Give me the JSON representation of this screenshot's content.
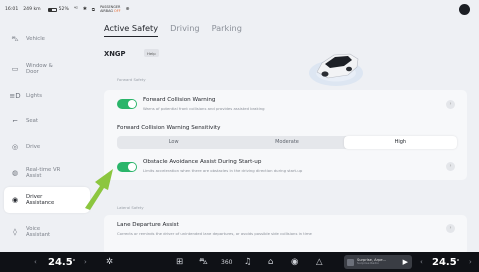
{
  "status": {
    "time": "16:01",
    "range": "249 km",
    "battery": "52%",
    "signal": "⁴ᴳ",
    "bluetooth": "✱",
    "camera": "⧉",
    "airbag_line1": "PASSENGER",
    "airbag_line2": "AIRBAG",
    "airbag_off": "OFF",
    "extra": "⊕"
  },
  "sidebar": {
    "items": [
      {
        "label": "Vehicle",
        "icon": "car-icon",
        "glyph": "⛍"
      },
      {
        "label": "Window &\nDoor",
        "icon": "window-icon",
        "glyph": "▭"
      },
      {
        "label": "Lights",
        "icon": "lights-icon",
        "glyph": "≡D"
      },
      {
        "label": "Seat",
        "icon": "seat-icon",
        "glyph": "⌐"
      },
      {
        "label": "Drive",
        "icon": "steering-icon",
        "glyph": "◎"
      },
      {
        "label": "Real-time VR\nAssist",
        "icon": "vr-icon",
        "glyph": "◍"
      },
      {
        "label": "Driver\nAssistance",
        "icon": "driver-assist-icon",
        "glyph": "◉"
      },
      {
        "label": "Voice\nAssistant",
        "icon": "voice-icon",
        "glyph": "◊"
      }
    ]
  },
  "tabs": [
    {
      "label": "Active Safety"
    },
    {
      "label": "Driving"
    },
    {
      "label": "Parking"
    }
  ],
  "model": {
    "name": "XNGP",
    "help": "Help"
  },
  "sections": {
    "forward": "Forward Safety",
    "lateral": "Lateral Safety"
  },
  "fcw": {
    "title": "Forward Collision Warning",
    "subtitle": "Warns of potential front collisions and provides assisted braking",
    "enabled": true
  },
  "sensitivity": {
    "label": "Forward Collision Warning Sensitivity",
    "options": [
      "Low",
      "Moderate",
      "High"
    ],
    "selected": "High"
  },
  "oaa": {
    "title": "Obstacle Avoidance Assist During Start-up",
    "subtitle": "Limits acceleration when there are obstacles in the driving direction during start-up",
    "enabled": true
  },
  "lda": {
    "title": "Lane Departure Assist",
    "subtitle": "Corrects or reminds the driver of unintended lane departures, or avoids possible side collisions in time"
  },
  "bottombar": {
    "temp_left": "24.5",
    "temp_right": "24.5",
    "temp_unit": "°",
    "icons": [
      "fan-icon",
      "apps-icon",
      "car-home-icon",
      "360-camera-icon",
      "music-icon",
      "home-icon",
      "navigation-icon",
      "warning-icon"
    ],
    "media_title": "Surprise, Arpe...",
    "media_sub": "Surprise Radio"
  },
  "colors": {
    "accent_green": "#2ab56a",
    "annotation_arrow": "#8cc63f"
  }
}
